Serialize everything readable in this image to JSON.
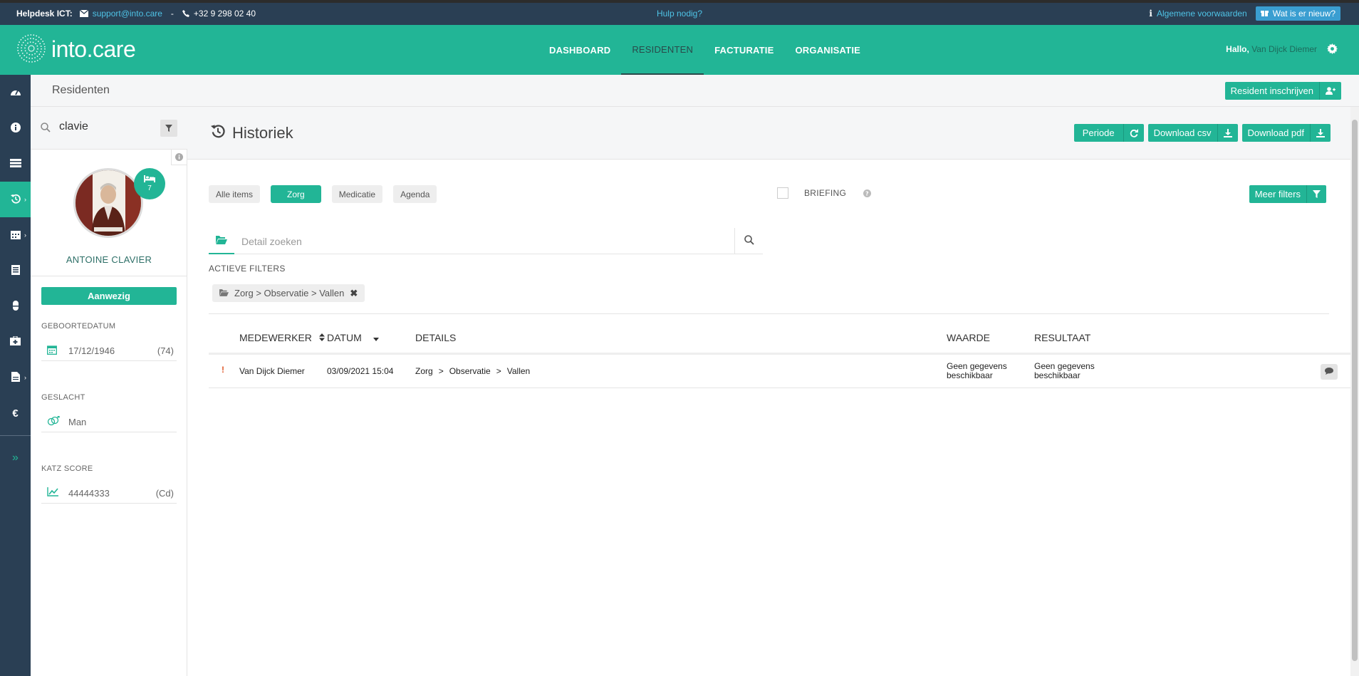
{
  "helpbar": {
    "helpdesk_label": "Helpdesk ICT:",
    "email": "support@into.care",
    "dash": "-",
    "phone": "+32 9 298 02 40",
    "help_link": "Hulp nodig?",
    "terms_link": "Algemene voorwaarden",
    "whats_new": "Wat is er nieuw?"
  },
  "header": {
    "logo_text": "into.care",
    "nav": [
      "DASHBOARD",
      "RESIDENTEN",
      "FACTURATIE",
      "ORGANISATIE"
    ],
    "active_nav": "RESIDENTEN",
    "greeting": "Hallo,",
    "username": "Van Dijck Diemer"
  },
  "colors": {
    "primary": "#22b596",
    "dark": "#2a3f54",
    "link": "#4fc3e6",
    "warn": "#e05a2b"
  },
  "rail": {
    "icons": [
      "dashboard-icon",
      "info-icon",
      "list-icon",
      "history-icon",
      "calendar-icon",
      "document-icon",
      "medication-icon",
      "first-aid-icon",
      "file-icon",
      "euro-icon",
      "expand-icon"
    ]
  },
  "page": {
    "title": "Residenten",
    "enroll_button": "Resident inschrijven"
  },
  "resident": {
    "search_value": "clavie",
    "bed_number": "7",
    "name": "ANTOINE CLAVIER",
    "status": "Aanwezig",
    "birth_label": "GEBOORTEDATUM",
    "birth_date": "17/12/1946",
    "age": "(74)",
    "gender_label": "GESLACHT",
    "gender": "Man",
    "katz_label": "KATZ SCORE",
    "katz_value": "44444333",
    "katz_code": "(Cd)"
  },
  "history": {
    "title": "Historiek",
    "buttons": {
      "period": "Periode",
      "csv": "Download csv",
      "pdf": "Download pdf"
    },
    "chips": [
      "Alle items",
      "Zorg",
      "Medicatie",
      "Agenda"
    ],
    "active_chip": "Zorg",
    "briefing_label": "BRIEFING",
    "more_filters": "Meer filters",
    "search_placeholder": "Detail zoeken",
    "active_filters_label": "ACTIEVE FILTERS",
    "active_filter": "Zorg > Observatie > Vallen",
    "columns": {
      "employee": "MEDEWERKER",
      "date": "DATUM",
      "details": "DETAILS",
      "value": "WAARDE",
      "result": "RESULTAAT"
    },
    "rows": [
      {
        "flag": "!",
        "employee": "Van Dijck Diemer",
        "date": "03/09/2021 15:04",
        "path": [
          "Zorg",
          ">",
          "Observatie",
          ">",
          "Vallen"
        ],
        "value_line1": "Geen gegevens",
        "value_line2": "beschikbaar",
        "result_line1": "Geen gegevens",
        "result_line2": "beschikbaar"
      }
    ]
  }
}
